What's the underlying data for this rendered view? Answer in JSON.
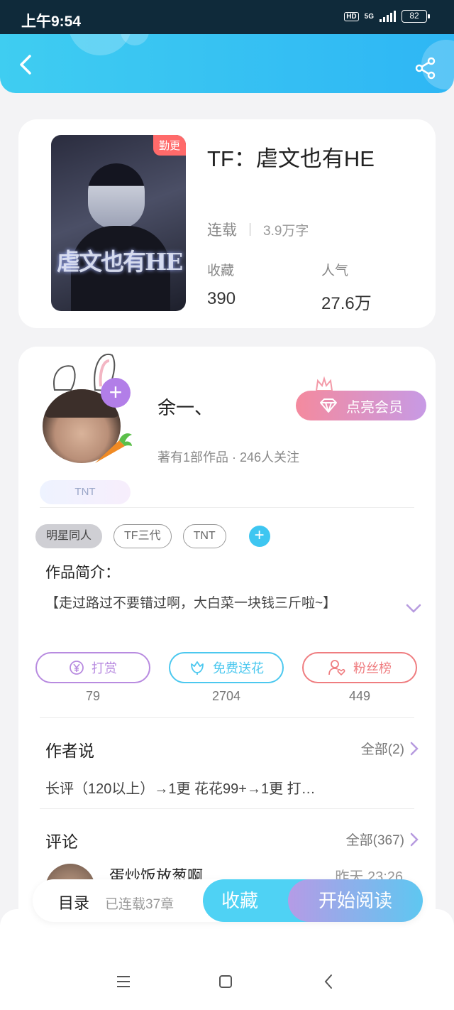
{
  "statusbar": {
    "time": "上午9:54",
    "hd": "HD",
    "network": "5G",
    "battery": "82"
  },
  "book": {
    "badge": "勤更",
    "cover_text": "虐文也有HE",
    "title": "TF：虐文也有HE",
    "status": "连载",
    "words": "3.9万字",
    "stats": [
      {
        "label": "收藏",
        "value": "390"
      },
      {
        "label": "人气",
        "value": "27.6万"
      }
    ]
  },
  "author": {
    "name": "余一、",
    "meta": "著有1部作品 · 246人关注",
    "vip_label": "点亮会员",
    "badge": "TNT",
    "avatar_plus": "+"
  },
  "tags": [
    "明星同人",
    "TF三代",
    "TNT"
  ],
  "tag_add": "+",
  "intro": {
    "heading": "作品简介：",
    "text": "【走过路过不要错过啊，大白菜一块钱三斤啦~】"
  },
  "actions": [
    {
      "label": "打赏",
      "count": "79",
      "color": "#b88be0"
    },
    {
      "label": "免费送花",
      "count": "2704",
      "color": "#4cc8ef"
    },
    {
      "label": "粉丝榜",
      "count": "449",
      "color": "#ef7d80"
    }
  ],
  "author_says": {
    "heading": "作者说",
    "more": "全部(2)",
    "text": "长评（120以上）→1更 花花99+→1更 打…"
  },
  "comments": {
    "heading": "评论",
    "more": "全部(367)",
    "first_user": "蛋炒饭放葱啊",
    "first_time": "昨天 23:26"
  },
  "bottom": {
    "toc": "目录",
    "toc_sub": "已连载37章",
    "favorite": "收藏",
    "read": "开始阅读"
  },
  "colors": {
    "header": "#3fcdf1",
    "vip": "#f48a9e",
    "accent_purple": "#b27ee8",
    "accent_blue": "#4fd2f4"
  }
}
